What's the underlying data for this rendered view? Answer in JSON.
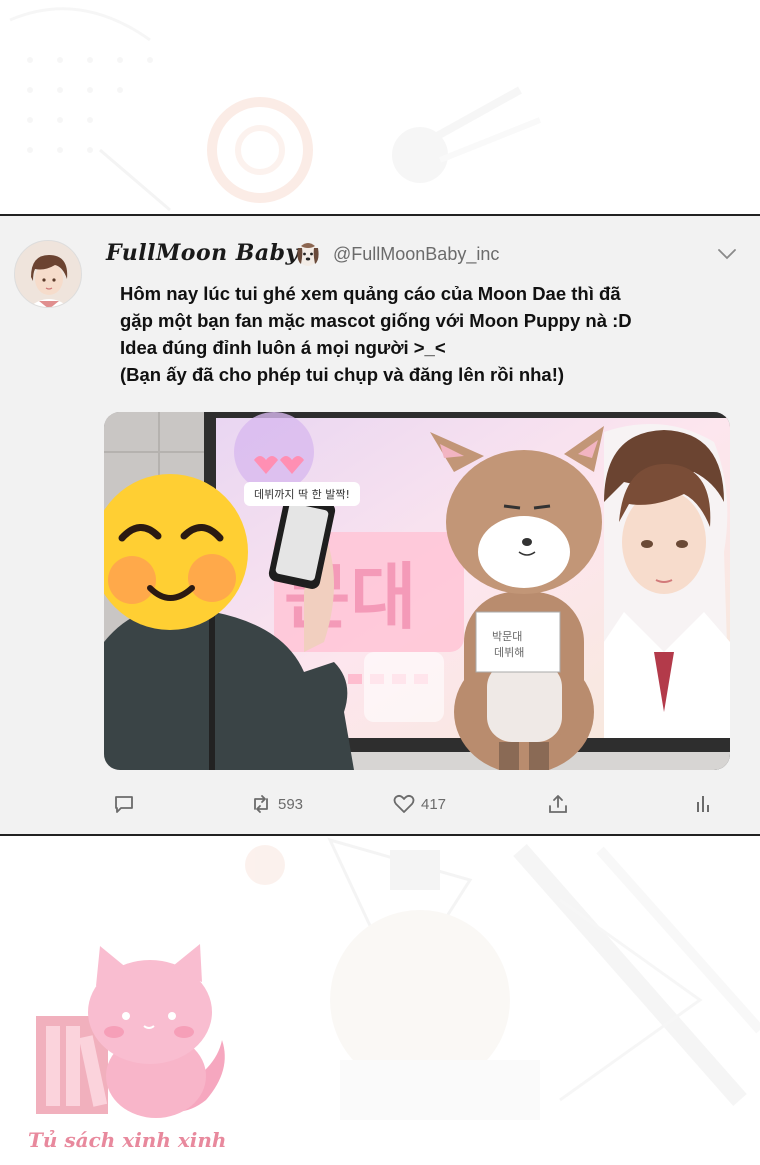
{
  "tweet": {
    "display_name": "FullMoon Baby",
    "name_emoji": "dog-face-emoji",
    "handle": "@FullMoonBaby_inc",
    "menu_icon": "chevron-down-icon",
    "text_lines": [
      "Hôm nay lúc tui ghé xem quảng cáo của Moon Dae thì đã",
      "gặp một bạn fan mặc mascot giống với Moon Puppy nà :D",
      "Idea đúng đỉnh luôn á mọi người >_<",
      "(Bạn ấy đã cho phép tui chụp và đăng lên rồi nha!)"
    ],
    "media": {
      "ad_caption": "데뷔까지 딱 한 발짝!"
    },
    "actions": {
      "reply_icon": "reply-icon",
      "retweet_icon": "retweet-icon",
      "retweet_count": "593",
      "like_icon": "heart-icon",
      "like_count": "417",
      "share_icon": "share-icon",
      "stats_icon": "stats-icon"
    }
  },
  "watermark": {
    "text": "Tủ sách xinh xinh"
  },
  "colors": {
    "card_bg": "#f2f2f2",
    "text": "#111111",
    "muted": "#6b6b6b",
    "watermark_pink": "#e8899d"
  }
}
